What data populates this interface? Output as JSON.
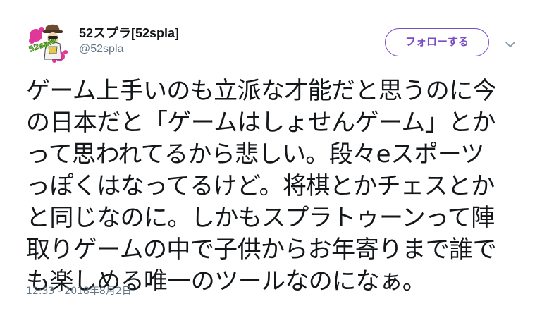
{
  "user": {
    "display_name": "52スプラ[52spla]",
    "handle": "@52spla",
    "avatar_icon": "avatar-illustration-icon",
    "avatar_logo_text": "52spla"
  },
  "follow_button": {
    "label": "フォローする"
  },
  "menu": {
    "icon": "chevron-down-icon"
  },
  "tweet": {
    "lines": [
      "ゲーム上手いのも立派な才能だと思うのに今",
      "の日本だと「ゲームはしょせんゲーム」とか",
      "って思われてるから悲しい。段々eスポーツ",
      "っぽくはなってるけど。将棋とかチェスとか",
      "と同じなのに。しかもスプラトゥーンって陣",
      "取りゲームの中で子供からお年寄りまで誰で",
      "も楽しめる唯一のツールなのになぁ。"
    ],
    "timestamp": "12:33 - 2018年8月2日"
  },
  "colors": {
    "accent": "#794bc4",
    "text": "#14171a",
    "secondary": "#657786",
    "avatar_pink": "#e0379a"
  }
}
